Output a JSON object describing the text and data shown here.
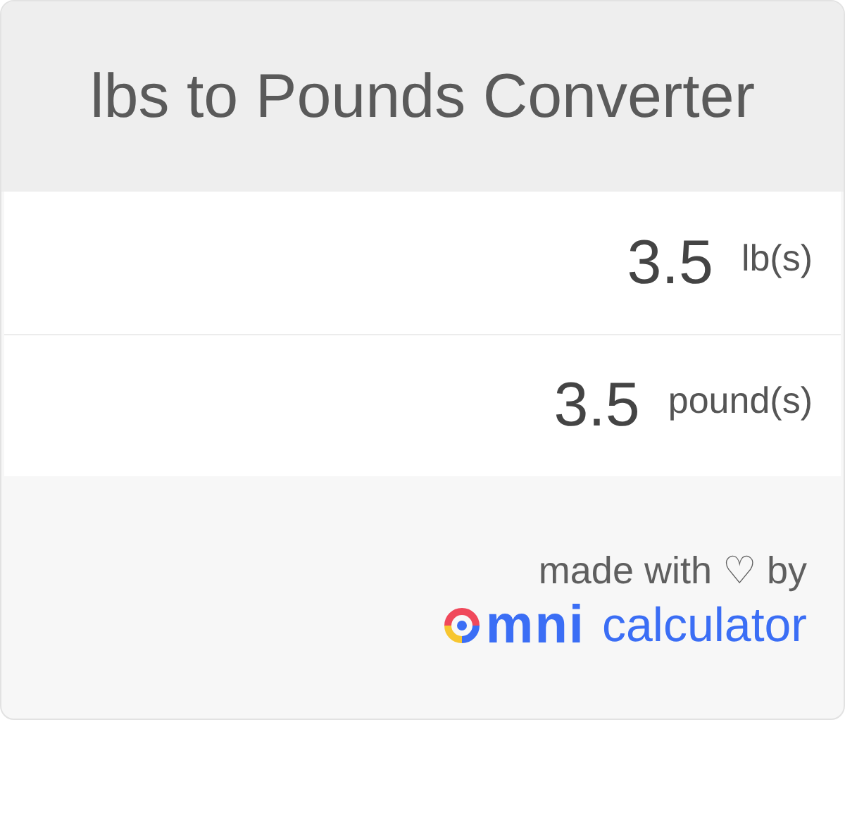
{
  "title": "lbs to Pounds Converter",
  "fields": [
    {
      "value": "3.5",
      "unit": "lb(s)"
    },
    {
      "value": "3.5",
      "unit": "pound(s)"
    }
  ],
  "footer": {
    "credit": "made with ♡ by",
    "logo_wordmark": "mni",
    "logo_product": "calculator"
  }
}
